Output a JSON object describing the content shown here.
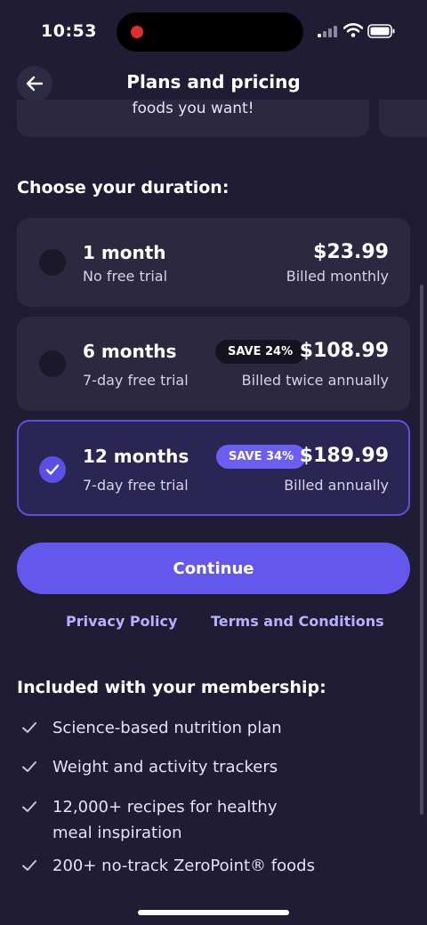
{
  "status": {
    "time": "10:53"
  },
  "header": {
    "title": "Plans and pricing"
  },
  "feature_peek": {
    "text": "foods you want!"
  },
  "duration": {
    "title": "Choose your duration:",
    "plans": [
      {
        "name": "1 month",
        "sub": "No free trial",
        "price": "$23.99",
        "billing": "Billed monthly",
        "badge": "",
        "selected": false
      },
      {
        "name": "6 months",
        "sub": "7-day free trial",
        "price": "$108.99",
        "billing": "Billed twice annually",
        "badge": "SAVE 24%",
        "selected": false
      },
      {
        "name": "12 months",
        "sub": "7-day free trial",
        "price": "$189.99",
        "billing": "Billed annually",
        "badge": "SAVE 34%",
        "selected": true
      }
    ]
  },
  "actions": {
    "continue_label": "Continue",
    "privacy_label": "Privacy Policy",
    "terms_label": "Terms and Conditions"
  },
  "membership": {
    "title": "Included with your membership:",
    "items": [
      "Science-based nutrition plan",
      "Weight and activity trackers",
      "12,000+ recipes for healthy meal inspiration",
      "200+ no-track ZeroPoint® foods"
    ]
  },
  "colors": {
    "background": "#1f1c33",
    "card": "#2b283f",
    "accent": "#6457ec",
    "link": "#b8b0ff"
  }
}
